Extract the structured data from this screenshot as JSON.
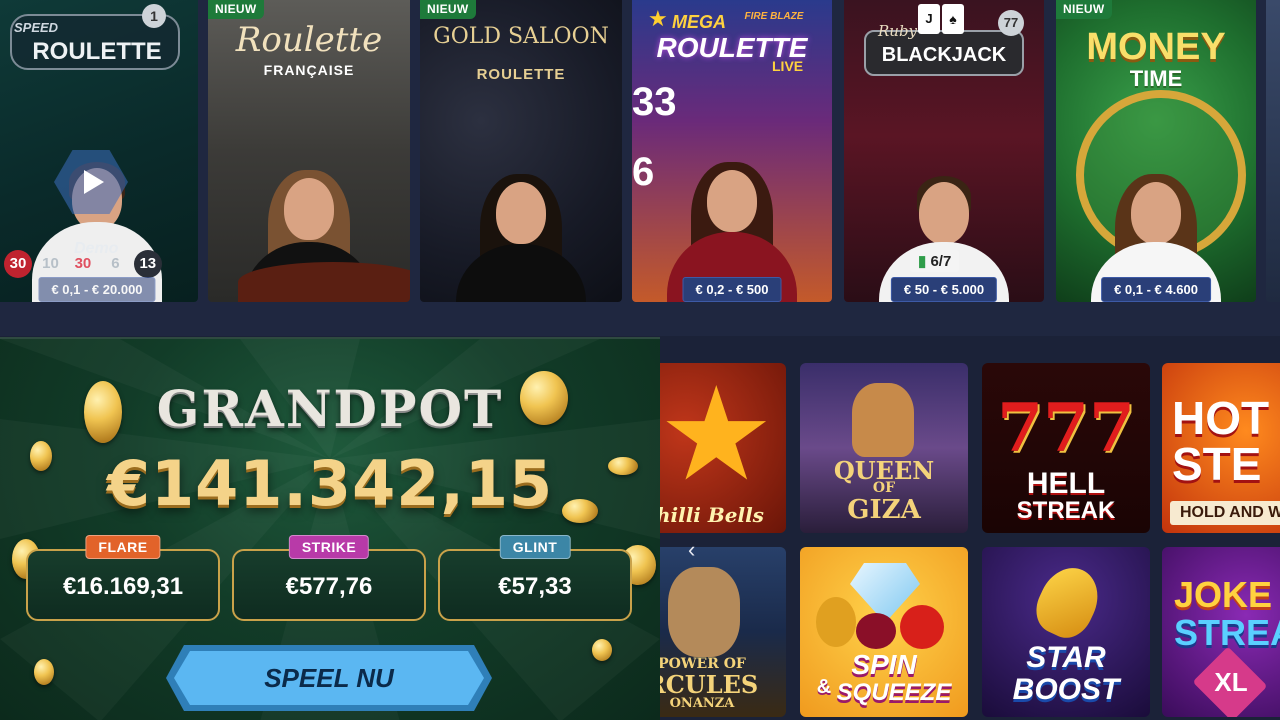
{
  "live_games": [
    {
      "title_top": "SPEED",
      "title": "ROULETTE",
      "badge_count": "1",
      "demo": "Demo",
      "numbers": [
        "30",
        "10",
        "30",
        "6",
        "13"
      ],
      "price": "€ 0,1 - € 20.000"
    },
    {
      "badge": "NIEUW",
      "title": "Roulette",
      "subtitle": "FRANÇAISE"
    },
    {
      "badge": "NIEUW",
      "title": "GOLD SALOON",
      "subtitle": "ROULETTE"
    },
    {
      "title_top": "MEGA",
      "title_top2": "FIRE BLAZE",
      "title": "ROULETTE",
      "subtitle": "LIVE",
      "side_numbers": [
        "33",
        "6"
      ],
      "price": "€ 0,2 - € 500"
    },
    {
      "title_top": "Ruby",
      "title": "BLACKJACK",
      "badge_count": "77",
      "seats": "6/7",
      "price": "€ 50 - € 5.000"
    },
    {
      "badge": "NIEUW",
      "title": "MONEY",
      "subtitle": "TIME",
      "price": "€ 0,1 - € 4.600"
    }
  ],
  "grandpot": {
    "logo": "GRANDPOT",
    "amount": "€141.342,15",
    "tiers": [
      {
        "name": "FLARE",
        "value": "€16.169,31",
        "color": "#e2632a"
      },
      {
        "name": "STRIKE",
        "value": "€577,76",
        "color": "#b83aa8"
      },
      {
        "name": "GLINT",
        "value": "€57,33",
        "color": "#3c86a6"
      }
    ],
    "cta": "SPEEL NU"
  },
  "slots": [
    {
      "name": "Chilli Bells"
    },
    {
      "name_1": "QUEEN",
      "name_2": "OF",
      "name_3": "GIZA"
    },
    {
      "name_1": "HELL",
      "name_2": "STREAK"
    },
    {
      "name_1": "HOT",
      "name_2": "STE",
      "name_3": "HOLD AND W"
    },
    {
      "name_1": "POWER OF",
      "name_2": "RCULES",
      "name_3": "ONANZA"
    },
    {
      "name_1": "SPIN",
      "name_2": "&",
      "name_3": "SQUEEZE"
    },
    {
      "name_1": "STAR",
      "name_2": "BOOST"
    },
    {
      "name_1": "JOKE",
      "name_2": "STREA",
      "name_3": "XL"
    }
  ],
  "carousel_prev": "‹"
}
